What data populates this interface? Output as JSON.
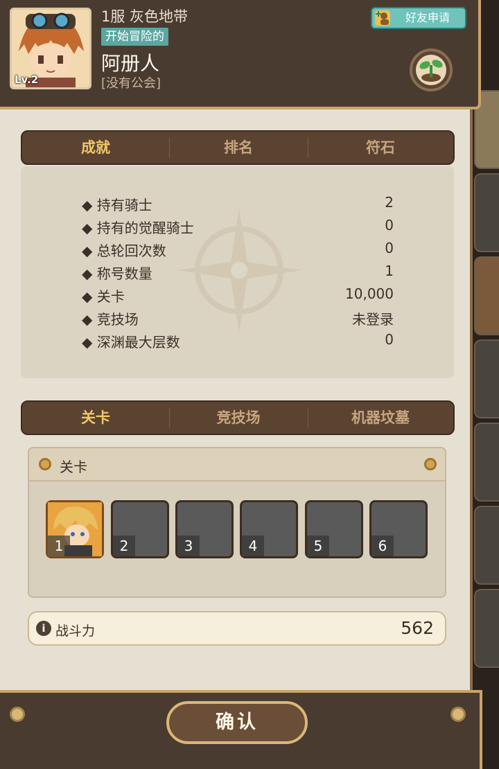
{
  "header": {
    "server": "1服 灰色地带",
    "status_badge": "开始冒险的",
    "player_name": "阿册人",
    "guild": "[没有公会]",
    "level": "Lv.2",
    "friend_request": "好友申请",
    "icons": {
      "friend": "add-friend-icon",
      "sprout": "sprout-icon"
    }
  },
  "top_tabs": [
    {
      "label": "成就",
      "active": true
    },
    {
      "label": "排名",
      "active": false
    },
    {
      "label": "符石",
      "active": false
    }
  ],
  "stats": [
    {
      "label": "持有骑士",
      "value": "2"
    },
    {
      "label": "持有的觉醒骑士",
      "value": "0"
    },
    {
      "label": "总轮回次数",
      "value": "0"
    },
    {
      "label": "称号数量",
      "value": "1"
    },
    {
      "label": "关卡",
      "value": "10,000"
    },
    {
      "label": "竞技场",
      "value": "未登录"
    },
    {
      "label": "深渊最大层数",
      "value": "0"
    }
  ],
  "mode_tabs": [
    {
      "label": "关卡",
      "active": true
    },
    {
      "label": "竞技场",
      "active": false
    },
    {
      "label": "机器坟墓",
      "active": false
    }
  ],
  "stage": {
    "title": "关卡",
    "slots": [
      {
        "num": "1",
        "filled": true
      },
      {
        "num": "2",
        "filled": false
      },
      {
        "num": "3",
        "filled": false
      },
      {
        "num": "4",
        "filled": false
      },
      {
        "num": "5",
        "filled": false
      },
      {
        "num": "6",
        "filled": false
      }
    ]
  },
  "power": {
    "label": "战斗力",
    "value": "562"
  },
  "footer": {
    "confirm": "确认"
  },
  "colors": {
    "accent": "#f0c66b",
    "badge": "#5aa7a0",
    "frame": "#c9a46a"
  }
}
